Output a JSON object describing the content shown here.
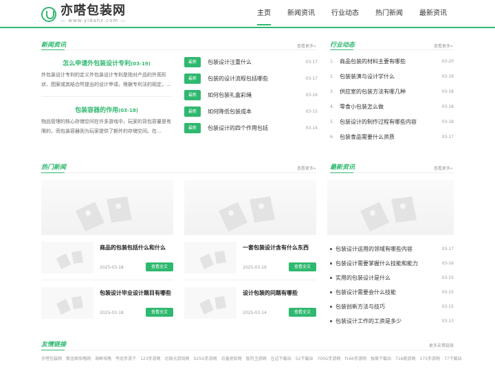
{
  "header": {
    "logo_name": "亦嗒包装网",
    "logo_url": "— www.yidahz.com —",
    "nav": [
      "主页",
      "新闻资讯",
      "行业动态",
      "热门新闻",
      "最新资讯"
    ]
  },
  "sections": {
    "news": {
      "title": "新闻资讯",
      "more": "查看更多»"
    },
    "industry": {
      "title": "行业动态",
      "more": "查看更多»"
    },
    "hot": {
      "title": "热门新闻",
      "more": "查看更多»"
    },
    "latest": {
      "title": "最新资讯",
      "more": "查看更多»"
    },
    "links": {
      "title": "友情链接",
      "more": "更多友情链接"
    }
  },
  "featured": [
    {
      "title": "怎么申请外包装设计专利",
      "date": "(03-19)",
      "desc": "外包装设计专利的定义外包装设计专利是指对产品的外观形状、图案或其结合所提出的设计申请。根据专利法的规定，..."
    },
    {
      "title": "包装容器的作用",
      "date": "(03-18)",
      "desc": "物品管理的核心存储空间在许多游戏中，玩家的背包容量是有限的，而包装容器则为玩家提供了额外的存储空间。在..."
    }
  ],
  "news_list": {
    "tag": "最新",
    "items": [
      {
        "title": "包装设计注重什么",
        "date": "03-17"
      },
      {
        "title": "包装的设计流程包括哪些",
        "date": "03-17"
      },
      {
        "title": "如何包装礼盒彩绳",
        "date": "03-16"
      },
      {
        "title": "如何降低包装成本",
        "date": "03-15"
      },
      {
        "title": "包装设计的四个作用包括",
        "date": "03-14"
      }
    ]
  },
  "industry_list": [
    {
      "num": "1.",
      "title": "商品包装的材料主要有哪些",
      "date": "03-20"
    },
    {
      "num": "2.",
      "title": "包装装潢与设计学什么",
      "date": "03-19"
    },
    {
      "num": "3.",
      "title": "供应室的包装方法有哪几种",
      "date": "03-18"
    },
    {
      "num": "4.",
      "title": "零食小包装怎么做",
      "date": "03-18"
    },
    {
      "num": "5.",
      "title": "包装设计的制作过程有哪些内容",
      "date": "03-18"
    },
    {
      "num": "6.",
      "title": "包装食品需要什么资质",
      "date": "03-17"
    }
  ],
  "hot_cards": {
    "button": "查看全文",
    "items": [
      {
        "title": "商品的包装包括什么和什么",
        "date": "2025-03-18"
      },
      {
        "title": "一套包装设计含有什么东西",
        "date": "2025-03-16"
      },
      {
        "title": "包装设计毕业设计题目有哪些",
        "date": "2025-03-18"
      },
      {
        "title": "设计包装的问题有哪些",
        "date": "2025-03-14"
      }
    ]
  },
  "latest_list": [
    {
      "title": "包装设计运用的领域有哪些内容",
      "date": "03-17"
    },
    {
      "title": "包装设计需要掌握什么技能和能力",
      "date": "03-16"
    },
    {
      "title": "实用的包装设计是什么",
      "date": "03-15"
    },
    {
      "title": "包装设计需要会什么技能",
      "date": "03-15"
    },
    {
      "title": "包装创新方法与技巧",
      "date": "03-15"
    },
    {
      "title": "包装设计工作的工资是多少",
      "date": "03-13"
    }
  ],
  "links": [
    "亦嗒包装网",
    "紫金阁攻略网",
    "海鲜攻略",
    "夸冠手游下",
    "123手游网",
    "北极光游戏网",
    "925G手游网",
    "访鑫地软网",
    "智符卫游网",
    "左边下载站",
    "52下载站",
    "700G手游网",
    "f166手游网",
    "独案下载站",
    "716跑游网",
    "175手游网",
    "77下载站"
  ],
  "colors": {
    "accent": "#2fb86f"
  }
}
